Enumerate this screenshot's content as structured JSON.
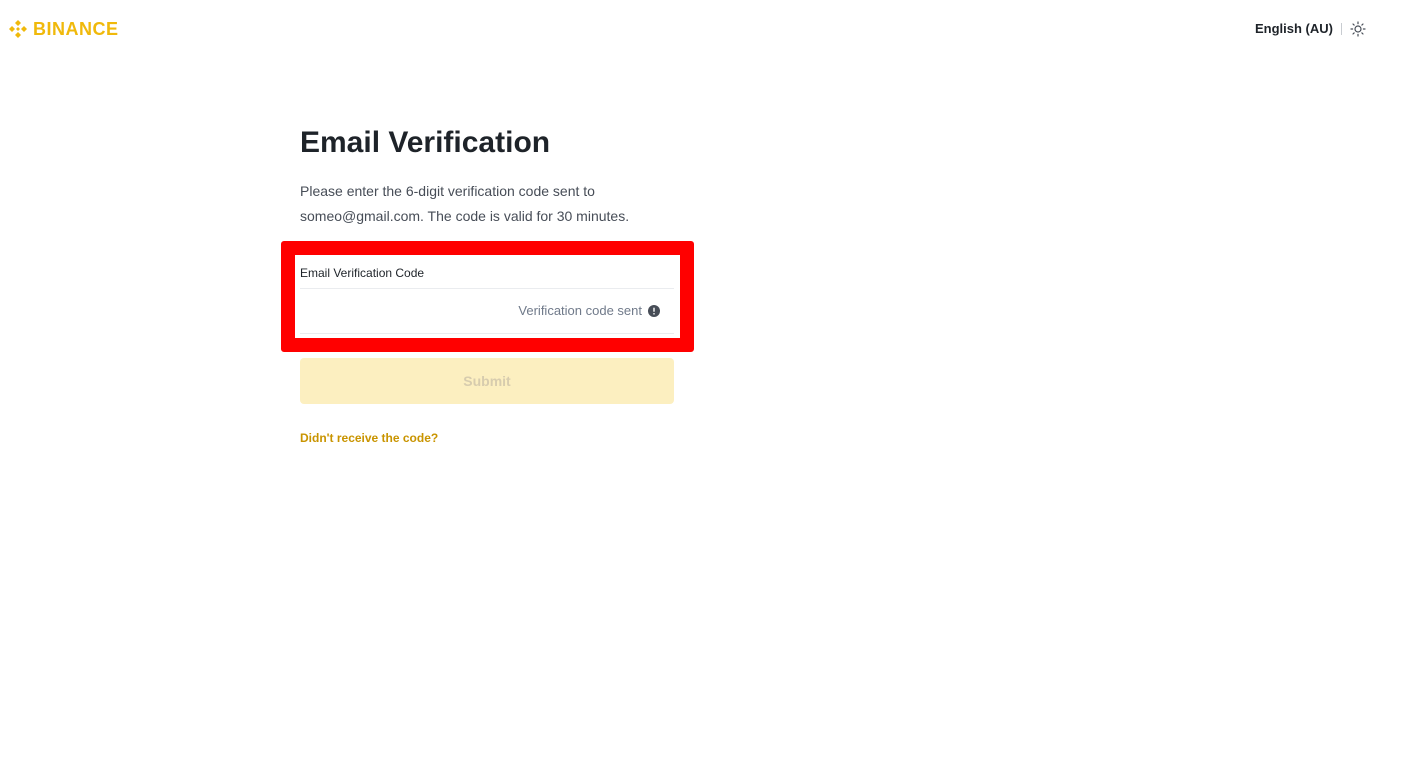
{
  "header": {
    "logo_text": "BINANCE",
    "language": "English (AU)",
    "theme_icon": "sun-icon",
    "brand_color": "#F0B90B"
  },
  "main": {
    "title": "Email Verification",
    "description_line1": "Please enter the 6-digit verification code sent to",
    "description_line2": "someo@gmail.com. The code is valid for 30 minutes.",
    "field_label": "Email Verification Code",
    "field_value": "",
    "code_status": "Verification code sent",
    "info_icon": "info-icon",
    "submit_label": "Submit",
    "resend_link": "Didn't receive the code?"
  },
  "colors": {
    "highlight_border": "#ff0000",
    "submit_disabled_bg": "#fcefc0",
    "link_color": "#C99400"
  }
}
